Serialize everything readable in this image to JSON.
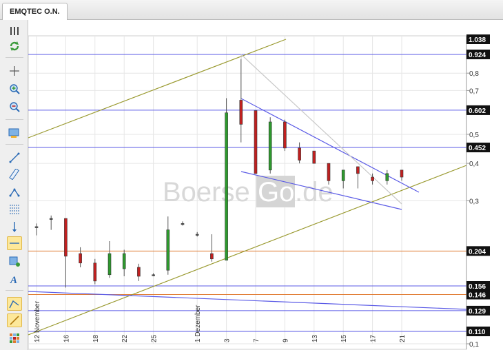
{
  "tab": {
    "label": "EMQTEC O.N."
  },
  "watermark": {
    "left": "Boerse",
    "mid": "Go",
    "right": ".de"
  },
  "colors": {
    "blue_line": "#5a5ae6",
    "orange_line": "#e07a30",
    "olive_line": "#9a9a30",
    "up": "#2e9a2e",
    "down": "#c02020"
  },
  "toolbar": {
    "icons": [
      "drag-handle-icon",
      "refresh-icon",
      "crosshair-icon",
      "zoom-in-icon",
      "zoom-out-icon",
      "screenshot-icon",
      "line-tool-icon",
      "ruler-icon",
      "polyline-icon",
      "fibonacci-icon",
      "vertical-line-icon",
      "horizontal-line-icon",
      "rectangle-icon",
      "text-tool-icon",
      "trendline-tool-icon",
      "ray-tool-icon",
      "grid-icon"
    ]
  },
  "chart_data": {
    "type": "candlestick",
    "y_scale": "log",
    "ylim": [
      0.1,
      1.038
    ],
    "y_ticks": [
      "0,1",
      "0,3",
      "0,4",
      "0,5",
      "0,7",
      "0,8"
    ],
    "price_labels": [
      "1.038",
      "0.924",
      "0.602",
      "0.452",
      "0.204",
      "0.156",
      "0.146",
      "0.129",
      "0.110"
    ],
    "x_ticks": [
      {
        "label": "12 November",
        "i": 0
      },
      {
        "label": "16",
        "i": 2
      },
      {
        "label": "18",
        "i": 4
      },
      {
        "label": "22",
        "i": 6
      },
      {
        "label": "25",
        "i": 8
      },
      {
        "label": "1 Dezember",
        "i": 11
      },
      {
        "label": "3",
        "i": 13
      },
      {
        "label": "7",
        "i": 15
      },
      {
        "label": "9",
        "i": 17
      },
      {
        "label": "13",
        "i": 19
      },
      {
        "label": "15",
        "i": 21
      },
      {
        "label": "17",
        "i": 23
      },
      {
        "label": "21",
        "i": 25
      }
    ],
    "candles": [
      {
        "o": 0.246,
        "h": 0.252,
        "l": 0.23,
        "c": 0.246
      },
      {
        "o": 0.262,
        "h": 0.268,
        "l": 0.24,
        "c": 0.262
      },
      {
        "o": 0.262,
        "h": 0.262,
        "l": 0.154,
        "c": 0.196
      },
      {
        "o": 0.2,
        "h": 0.21,
        "l": 0.18,
        "c": 0.186
      },
      {
        "o": 0.186,
        "h": 0.192,
        "l": 0.158,
        "c": 0.162
      },
      {
        "o": 0.17,
        "h": 0.22,
        "l": 0.166,
        "c": 0.2
      },
      {
        "o": 0.178,
        "h": 0.206,
        "l": 0.168,
        "c": 0.2
      },
      {
        "o": 0.18,
        "h": 0.185,
        "l": 0.162,
        "c": 0.168
      },
      {
        "o": 0.17,
        "h": 0.172,
        "l": 0.168,
        "c": 0.17
      },
      {
        "o": 0.176,
        "h": 0.266,
        "l": 0.17,
        "c": 0.24
      },
      {
        "o": 0.252,
        "h": 0.256,
        "l": 0.248,
        "c": 0.252
      },
      {
        "o": 0.232,
        "h": 0.236,
        "l": 0.228,
        "c": 0.232
      },
      {
        "o": 0.2,
        "h": 0.232,
        "l": 0.188,
        "c": 0.192
      },
      {
        "o": 0.19,
        "h": 0.66,
        "l": 0.19,
        "c": 0.59
      },
      {
        "o": 0.65,
        "h": 0.89,
        "l": 0.47,
        "c": 0.54
      },
      {
        "o": 0.6,
        "h": 0.6,
        "l": 0.37,
        "c": 0.37
      },
      {
        "o": 0.38,
        "h": 0.57,
        "l": 0.37,
        "c": 0.55
      },
      {
        "o": 0.55,
        "h": 0.56,
        "l": 0.44,
        "c": 0.45
      },
      {
        "o": 0.45,
        "h": 0.47,
        "l": 0.4,
        "c": 0.41
      },
      {
        "o": 0.44,
        "h": 0.44,
        "l": 0.4,
        "c": 0.4
      },
      {
        "o": 0.4,
        "h": 0.4,
        "l": 0.34,
        "c": 0.35
      },
      {
        "o": 0.35,
        "h": 0.38,
        "l": 0.33,
        "c": 0.38
      },
      {
        "o": 0.39,
        "h": 0.39,
        "l": 0.33,
        "c": 0.37
      },
      {
        "o": 0.36,
        "h": 0.37,
        "l": 0.34,
        "c": 0.35
      },
      {
        "o": 0.35,
        "h": 0.38,
        "l": 0.34,
        "c": 0.37
      },
      {
        "o": 0.38,
        "h": 0.38,
        "l": 0.35,
        "c": 0.36
      }
    ],
    "hlines": [
      {
        "v": 0.924,
        "color": "#5a5ae6"
      },
      {
        "v": 0.602,
        "color": "#5a5ae6"
      },
      {
        "v": 0.452,
        "color": "#5a5ae6"
      },
      {
        "v": 0.204,
        "color": "#e07a30"
      },
      {
        "v": 0.156,
        "color": "#5a5ae6"
      },
      {
        "v": 0.146,
        "color": "#e07a30"
      },
      {
        "v": 0.129,
        "color": "#5a5ae6"
      },
      {
        "v": 0.11,
        "color": "#5a5ae6"
      }
    ]
  }
}
